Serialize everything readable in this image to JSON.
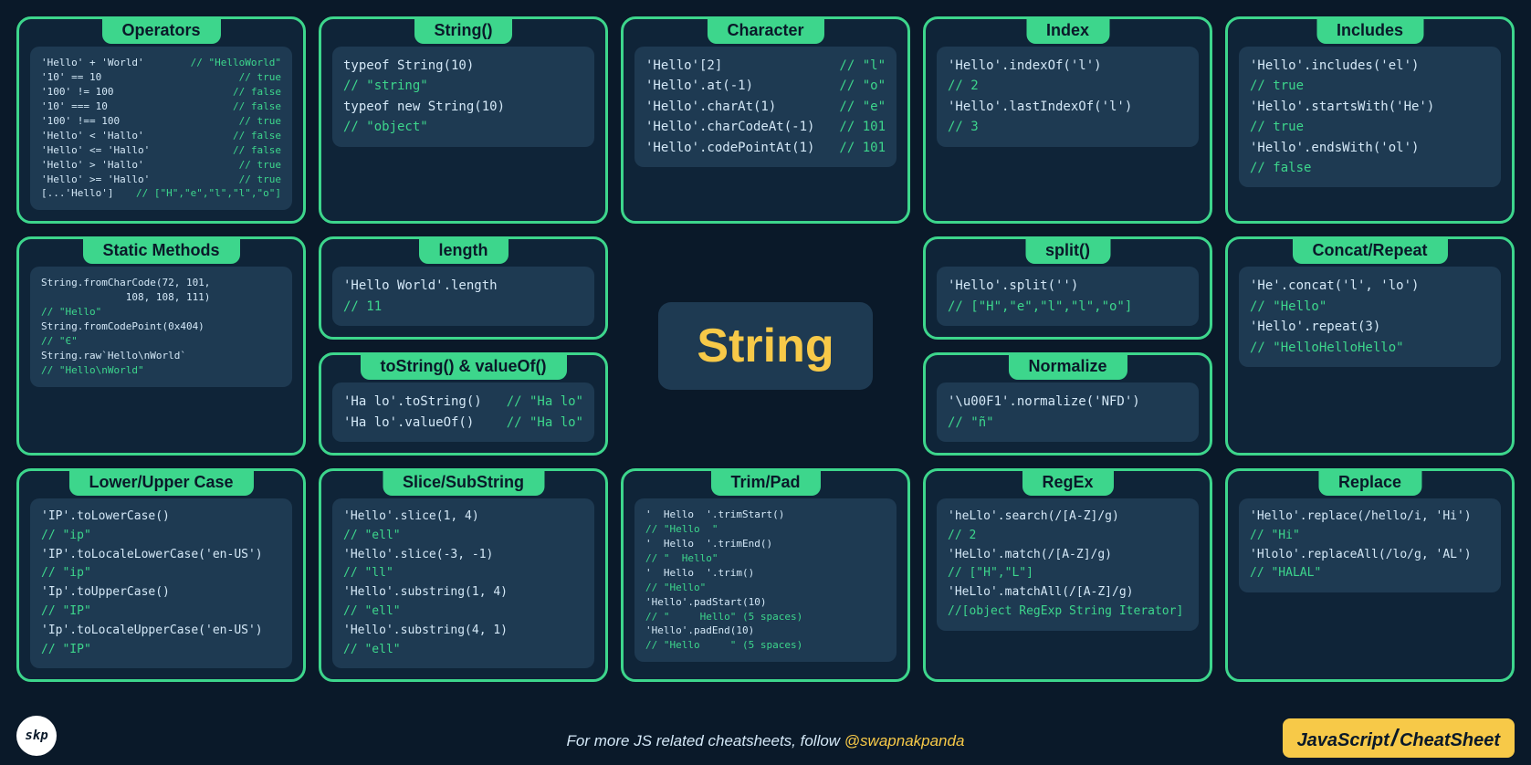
{
  "center": "String",
  "footer_text": "For more JS related cheatsheets, follow ",
  "footer_handle": "@swapnakpanda",
  "brand_left": "JavaScript",
  "brand_right": "CheatSheet",
  "logo": "skp",
  "cards": {
    "operators": {
      "title": "Operators",
      "lines": [
        {
          "l": "'Hello' + 'World'",
          "r": "// \"HelloWorld\""
        },
        {
          "l": "'10' == 10",
          "r": "// true"
        },
        {
          "l": "'100' != 100",
          "r": "// false"
        },
        {
          "l": "'10' === 10",
          "r": "// false"
        },
        {
          "l": "'100' !== 100",
          "r": "// true"
        },
        {
          "l": "'Hello' < 'Hallo'",
          "r": "// false"
        },
        {
          "l": "'Hello' <= 'Hallo'",
          "r": "// false"
        },
        {
          "l": "'Hello' > 'Hallo'",
          "r": "// true"
        },
        {
          "l": "'Hello' >= 'Hallo'",
          "r": "// true"
        },
        {
          "l": "[...'Hello']",
          "r": "// [\"H\",\"e\",\"l\",\"l\",\"o\"]"
        }
      ]
    },
    "string_ctor": {
      "title": "String()",
      "lines": [
        {
          "t": "typeof String(10)"
        },
        {
          "c": "// \"string\""
        },
        {
          "t": ""
        },
        {
          "t": "typeof new String(10)"
        },
        {
          "c": "// \"object\""
        }
      ]
    },
    "character": {
      "title": "Character",
      "lines": [
        {
          "l": "'Hello'[2]",
          "r": "// \"l\""
        },
        {
          "l": "'Hello'.at(-1)",
          "r": "// \"o\""
        },
        {
          "l": "'Hello'.charAt(1)",
          "r": "// \"e\""
        },
        {
          "l": "'Hello'.charCodeAt(-1)",
          "r": "// 101"
        },
        {
          "l": "'Hello'.codePointAt(1)",
          "r": "// 101"
        }
      ]
    },
    "index": {
      "title": "Index",
      "lines": [
        {
          "t": "'Hello'.indexOf('l')"
        },
        {
          "c": "// 2"
        },
        {
          "t": ""
        },
        {
          "t": "'Hello'.lastIndexOf('l')"
        },
        {
          "c": "// 3"
        }
      ]
    },
    "includes": {
      "title": "Includes",
      "lines": [
        {
          "t": "'Hello'.includes('el')"
        },
        {
          "c": "// true"
        },
        {
          "t": "'Hello'.startsWith('He')"
        },
        {
          "c": "// true"
        },
        {
          "t": "'Hello'.endsWith('ol')"
        },
        {
          "c": "// false"
        }
      ]
    },
    "static_methods": {
      "title": "Static Methods",
      "lines": [
        {
          "t": "String.fromCharCode(72, 101,"
        },
        {
          "t": "              108, 108, 111)"
        },
        {
          "c": "// \"Hello\""
        },
        {
          "t": "String.fromCodePoint(0x404)"
        },
        {
          "c": "// \"Є\""
        },
        {
          "t": "String.raw`Hello\\nWorld`"
        },
        {
          "c": "// \"Hello\\nWorld\""
        }
      ]
    },
    "length": {
      "title": "length",
      "lines": [
        {
          "t": "'Hello World'.length"
        },
        {
          "c": "// 11"
        }
      ]
    },
    "tostring": {
      "title": "toString() & valueOf()",
      "lines": [
        {
          "l": "'Ha lo'.toString()",
          "r": "// \"Ha lo\""
        },
        {
          "l": "'Ha lo'.valueOf()",
          "r": "// \"Ha lo\""
        }
      ]
    },
    "split": {
      "title": "split()",
      "lines": [
        {
          "t": "'Hello'.split('')"
        },
        {
          "c": "// [\"H\",\"e\",\"l\",\"l\",\"o\"]"
        }
      ]
    },
    "normalize": {
      "title": "Normalize",
      "lines": [
        {
          "t": "'\\u00F1'.normalize('NFD')"
        },
        {
          "c": "// \"ñ\""
        }
      ]
    },
    "concat": {
      "title": "Concat/Repeat",
      "lines": [
        {
          "t": "'He'.concat('l', 'lo')"
        },
        {
          "c": "// \"Hello\""
        },
        {
          "t": ""
        },
        {
          "t": "'Hello'.repeat(3)"
        },
        {
          "c": "// \"HelloHelloHello\""
        }
      ]
    },
    "case": {
      "title": "Lower/Upper Case",
      "lines": [
        {
          "t": "'IP'.toLowerCase()"
        },
        {
          "c": "// \"ip\""
        },
        {
          "t": "'IP'.toLocaleLowerCase('en-US')"
        },
        {
          "c": "// \"ip\""
        },
        {
          "t": "'Ip'.toUpperCase()"
        },
        {
          "c": "// \"IP\""
        },
        {
          "t": "'Ip'.toLocaleUpperCase('en-US')"
        },
        {
          "c": "// \"IP\""
        }
      ]
    },
    "slice": {
      "title": "Slice/SubString",
      "lines": [
        {
          "t": "'Hello'.slice(1, 4)"
        },
        {
          "c": "// \"ell\""
        },
        {
          "t": "'Hello'.slice(-3, -1)"
        },
        {
          "c": "// \"ll\""
        },
        {
          "t": "'Hello'.substring(1, 4)"
        },
        {
          "c": "// \"ell\""
        },
        {
          "t": "'Hello'.substring(4, 1)"
        },
        {
          "c": "// \"ell\""
        }
      ]
    },
    "trim": {
      "title": "Trim/Pad",
      "lines": [
        {
          "t": "'  Hello  '.trimStart()"
        },
        {
          "c": "// \"Hello  \""
        },
        {
          "t": "'  Hello  '.trimEnd()"
        },
        {
          "c": "// \"  Hello\""
        },
        {
          "t": "'  Hello  '.trim()"
        },
        {
          "c": "// \"Hello\""
        },
        {
          "t": "'Hello'.padStart(10)"
        },
        {
          "c": "// \"     Hello\" (5 spaces)"
        },
        {
          "t": "'Hello'.padEnd(10)"
        },
        {
          "c": "// \"Hello     \" (5 spaces)"
        }
      ]
    },
    "regex": {
      "title": "RegEx",
      "lines": [
        {
          "t": "'heLlo'.search(/[A-Z]/g)"
        },
        {
          "c": "// 2"
        },
        {
          "t": "'HeLlo'.match(/[A-Z]/g)"
        },
        {
          "c": "// [\"H\",\"L\"]"
        },
        {
          "t": "'HeLlo'.matchAll(/[A-Z]/g)"
        },
        {
          "c": "//[object RegExp String Iterator]"
        }
      ]
    },
    "replace": {
      "title": "Replace",
      "lines": [
        {
          "t": "'Hello'.replace(/hello/i, 'Hi')"
        },
        {
          "c": "// \"Hi\""
        },
        {
          "t": ""
        },
        {
          "t": "'Hlolo'.replaceAll(/lo/g, 'AL')"
        },
        {
          "c": "// \"HALAL\""
        }
      ]
    }
  }
}
